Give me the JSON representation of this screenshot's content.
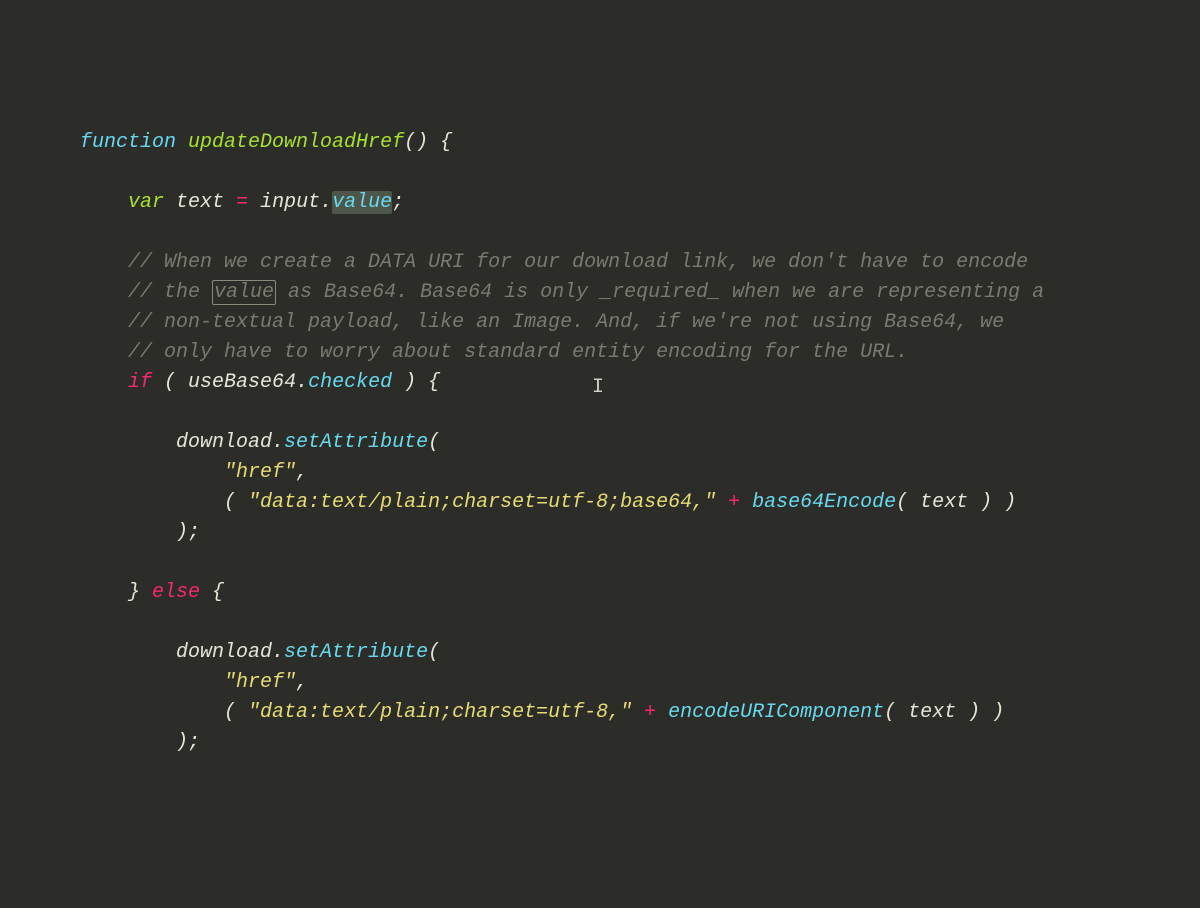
{
  "code": {
    "l1": {
      "fn": "function",
      "name": "updateDownloadHref",
      "paren": "() {"
    },
    "l2": "",
    "l3": {
      "var": "var",
      "ident": "text ",
      "eq": "=",
      "rhs1": " input",
      "dot": ".",
      "prop": "value",
      "semi": ";"
    },
    "l4": "",
    "c1": "// When we create a DATA URI for our download link, we don't have to encode",
    "c2a": "// the ",
    "c2b": "value",
    "c2c": " as Base64. Base64 is only _required_ when we are representing a",
    "c3": "// non-textual payload, like an Image. And, if we're not using Base64, we",
    "c4": "// only have to worry about standard entity encoding for the URL.",
    "l9": {
      "if": "if",
      "pre": " ( ",
      "ident": "useBase64",
      "dot": ".",
      "prop": "checked",
      "post": " ) {"
    },
    "l10": "",
    "l11": {
      "ident": "download",
      "dot": ".",
      "call": "setAttribute",
      "open": "("
    },
    "l12": {
      "str": "\"href\"",
      "comma": ","
    },
    "l13": {
      "open": "( ",
      "str": "\"data:text/plain;charset=utf-8;base64,\"",
      "plus": " + ",
      "fn": "base64Encode",
      "args": "( text ) )"
    },
    "l14": ");",
    "l15": "",
    "l16": {
      "close": "} ",
      "else": "else",
      "open": " {"
    },
    "l17": "",
    "l18": {
      "ident": "download",
      "dot": ".",
      "call": "setAttribute",
      "open": "("
    },
    "l19": {
      "str": "\"href\"",
      "comma": ","
    },
    "l20": {
      "open": "( ",
      "str": "\"data:text/plain;charset=utf-8,\"",
      "plus": " + ",
      "fn": "encodeURIComponent",
      "args": "( text ) )"
    },
    "l21": ");"
  },
  "cursor_glyph": "I"
}
